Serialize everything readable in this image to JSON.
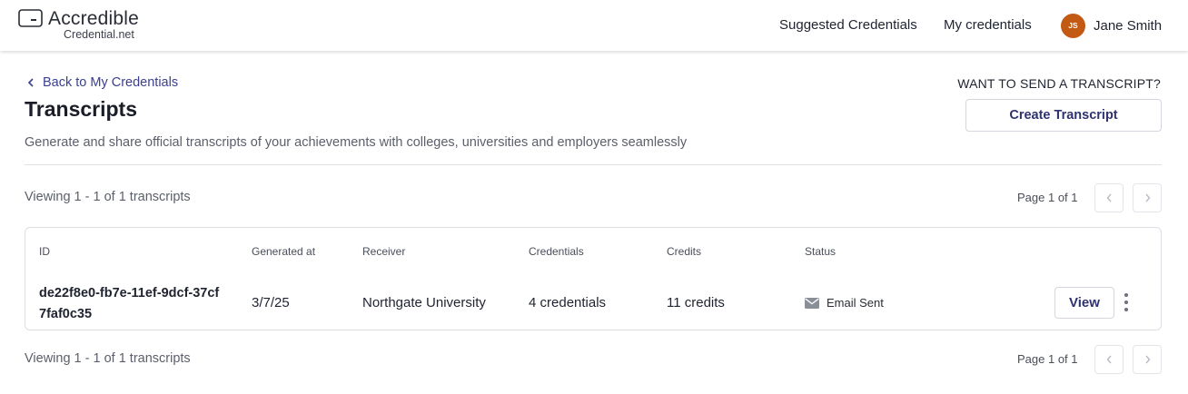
{
  "header": {
    "logo_name": "Accredible",
    "logo_sub": "Credential.net",
    "nav": {
      "suggested": "Suggested Credentials",
      "my_credentials": "My credentials"
    },
    "user": {
      "initials": "JS",
      "name": "Jane Smith"
    }
  },
  "page": {
    "back_label": "Back to My Credentials",
    "title": "Transcripts",
    "description": "Generate and share official transcripts of your achievements with colleges, universities and employers seamlessly",
    "want_label": "WANT TO SEND A TRANSCRIPT?",
    "create_label": "Create Transcript"
  },
  "pagination": {
    "viewing": "Viewing 1 - 1 of 1 transcripts",
    "page_info": "Page 1 of 1"
  },
  "table": {
    "columns": [
      "ID",
      "Generated at",
      "Receiver",
      "Credentials",
      "Credits",
      "Status"
    ],
    "rows": [
      {
        "id": "de22f8e0-fb7e-11ef-9dcf-37cf7faf0c35",
        "generated_at": "3/7/25",
        "receiver": "Northgate University",
        "credentials": "4 credentials",
        "credits": "11 credits",
        "status": "Email Sent",
        "status_icon": "envelope-icon",
        "view_label": "View"
      }
    ]
  },
  "colors": {
    "accent": "#3a3f8f",
    "avatar": "#c25a14"
  }
}
